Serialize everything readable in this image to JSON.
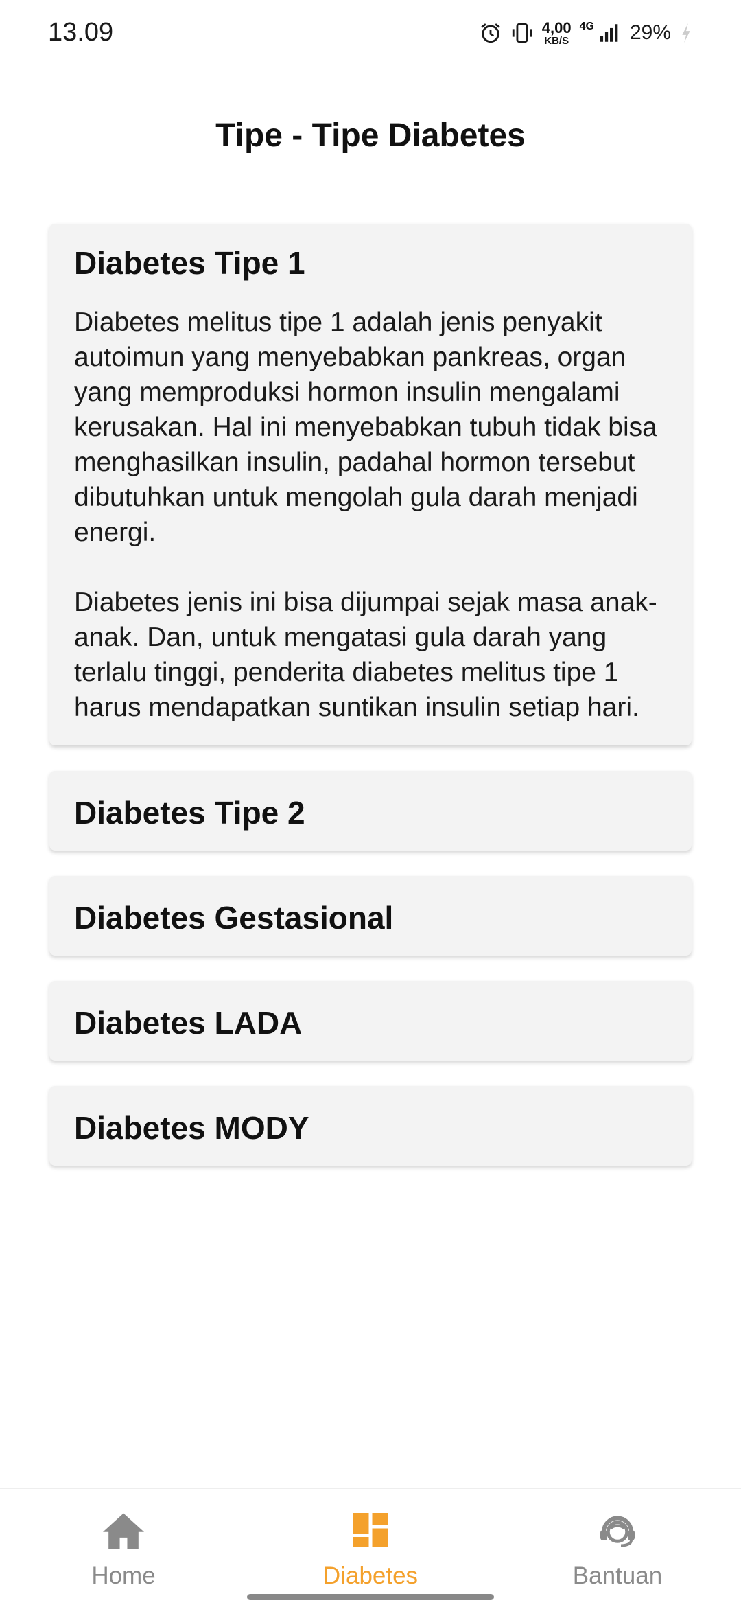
{
  "status_bar": {
    "time": "13.09",
    "speed_value": "4,00",
    "speed_unit": "KB/S",
    "network": "4G",
    "battery": "29%",
    "icons": [
      "alarm-icon",
      "vibrate-icon",
      "signal-icon",
      "battery-charging-icon"
    ]
  },
  "header": {
    "title": "Tipe - Tipe Diabetes"
  },
  "cards": [
    {
      "title": "Diabetes Tipe 1",
      "expanded": true,
      "paragraphs": [
        "Diabetes melitus tipe 1 adalah jenis penyakit autoimun yang menyebabkan pankreas, organ yang memproduksi hormon insulin mengalami kerusakan. Hal ini menyebabkan tubuh tidak bisa menghasilkan insulin, padahal hormon tersebut dibutuhkan untuk mengolah gula darah menjadi energi.",
        "Diabetes jenis ini bisa dijumpai sejak masa anak-anak. Dan, untuk mengatasi gula darah yang terlalu tinggi, penderita diabetes melitus tipe 1 harus mendapatkan suntikan insulin setiap hari."
      ]
    },
    {
      "title": "Diabetes Tipe 2",
      "expanded": false
    },
    {
      "title": "Diabetes Gestasional",
      "expanded": false
    },
    {
      "title": "Diabetes LADA",
      "expanded": false
    },
    {
      "title": "Diabetes MODY",
      "expanded": false
    }
  ],
  "bottom_nav": {
    "items": [
      {
        "label": "Home",
        "icon": "home-icon",
        "active": false
      },
      {
        "label": "Diabetes",
        "icon": "dashboard-icon",
        "active": true
      },
      {
        "label": "Bantuan",
        "icon": "support-agent-icon",
        "active": false
      }
    ]
  },
  "colors": {
    "accent": "#f4a12c",
    "inactive": "#8a8a8a",
    "card_bg": "#f3f3f3"
  }
}
